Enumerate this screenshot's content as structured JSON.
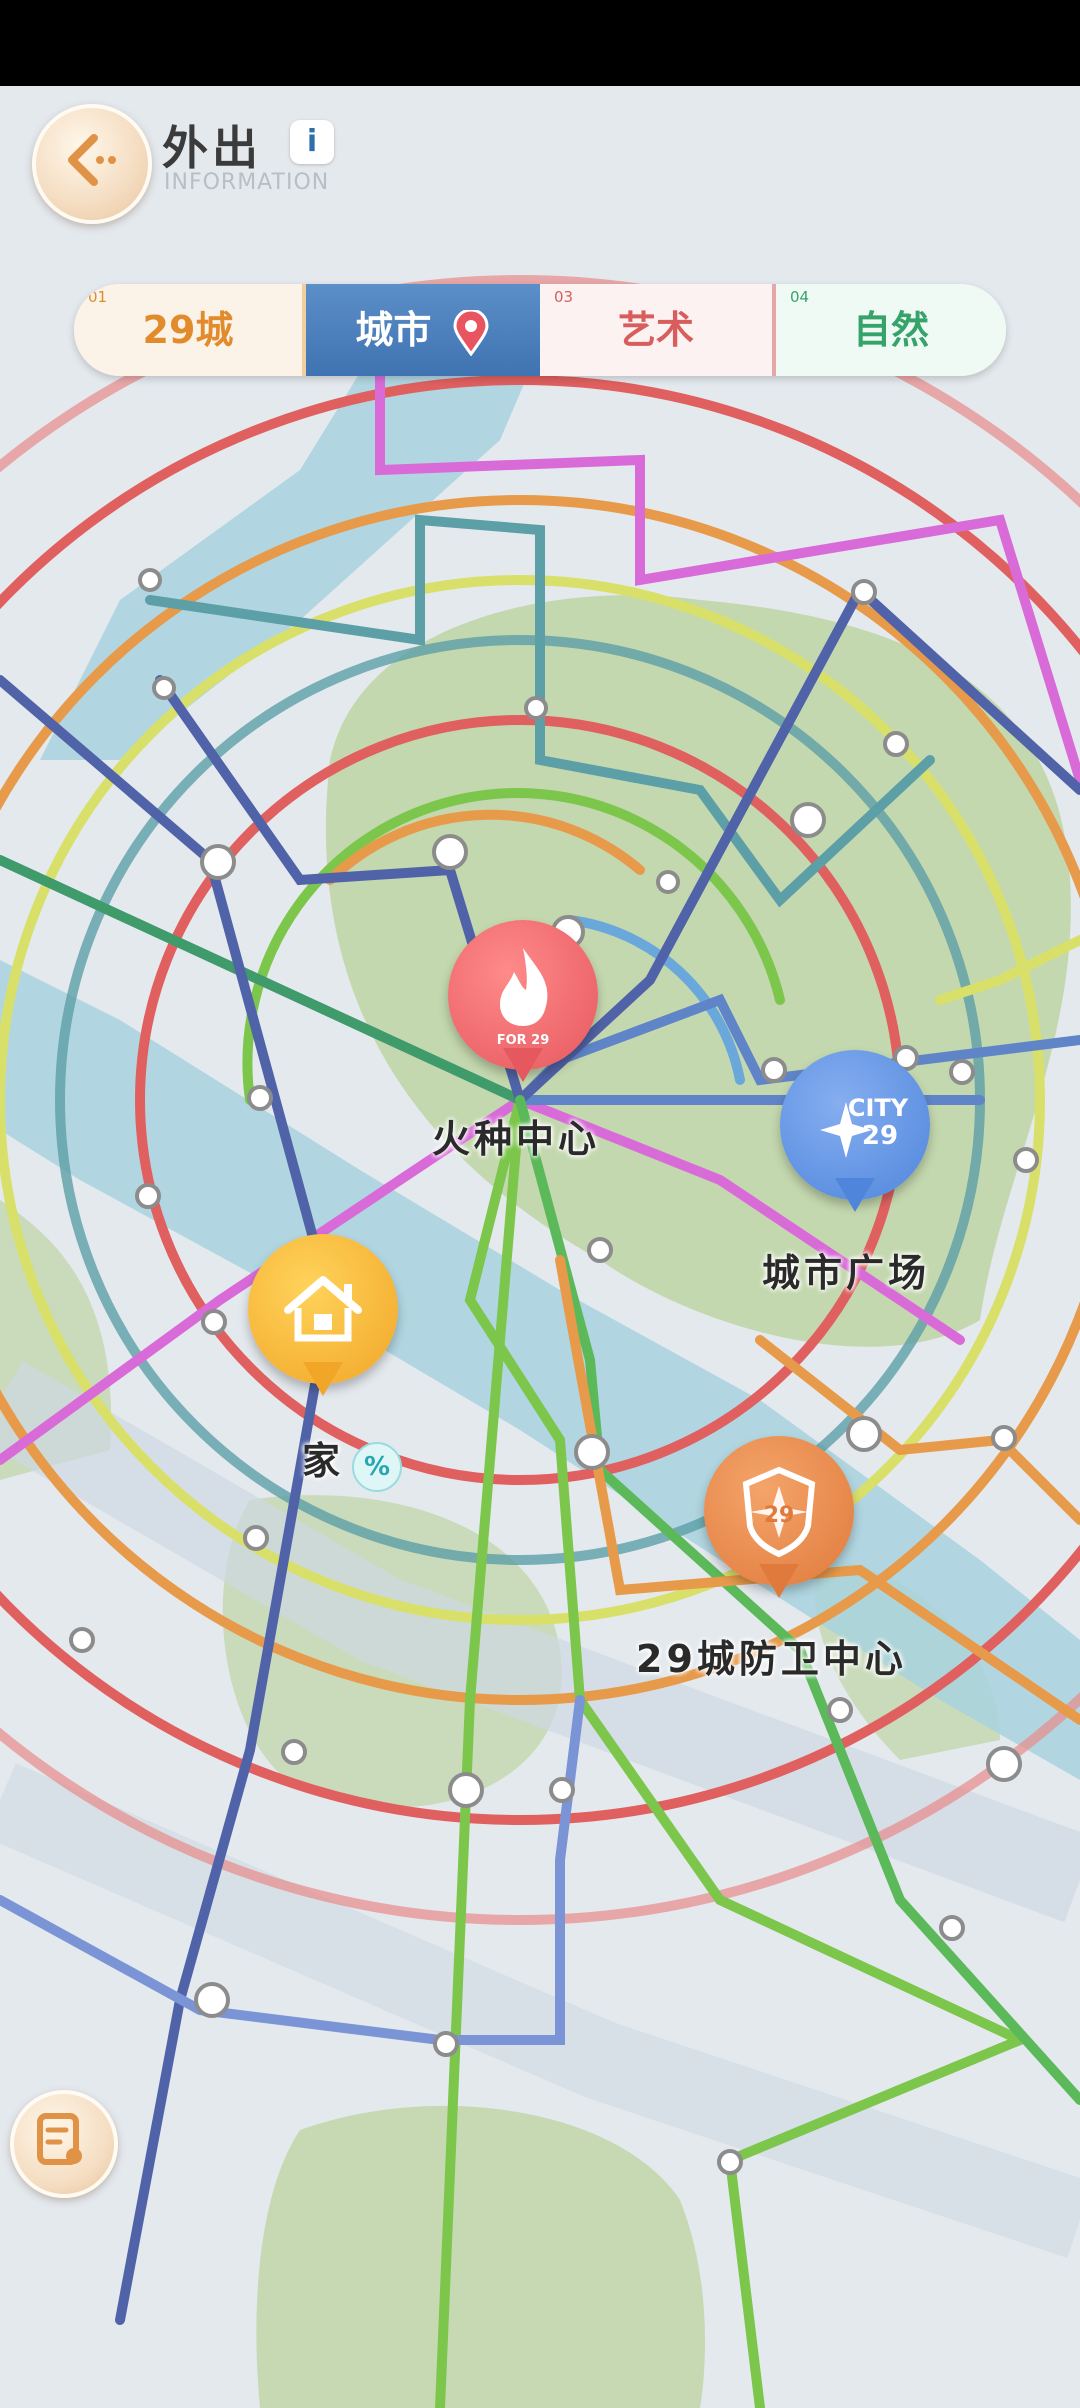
{
  "header": {
    "title": "外出",
    "subtitle": "INFORMATION",
    "info_icon": "i",
    "back_icon": "back-arrow-icon"
  },
  "tabs": [
    {
      "num": "01",
      "label": "29城",
      "selected": false
    },
    {
      "num": "",
      "label": "城市",
      "selected": true
    },
    {
      "num": "03",
      "label": "艺术",
      "selected": false
    },
    {
      "num": "04",
      "label": "自然",
      "selected": false
    }
  ],
  "locations": {
    "fire_center": {
      "label": "火种中心",
      "badge_text": "FOR 29",
      "color": "#e5585e"
    },
    "city_plaza": {
      "label": "城市广场",
      "badge_text": "CITY 29",
      "color": "#4f86dc"
    },
    "home": {
      "label": "家",
      "color": "#f1a628",
      "discount_icon": "%"
    },
    "defense_center": {
      "label": "29城防卫中心",
      "badge_text": "29",
      "color": "#e07a3c"
    }
  },
  "bottom_button_icon": "map-note-icon",
  "colors": {
    "selected_tab": "#4a7fbd",
    "line_red": "#e06060",
    "line_green": "#7cc64c",
    "line_magenta": "#d96bd9",
    "line_blue": "#5f85c8",
    "line_orange": "#e79a4a"
  }
}
